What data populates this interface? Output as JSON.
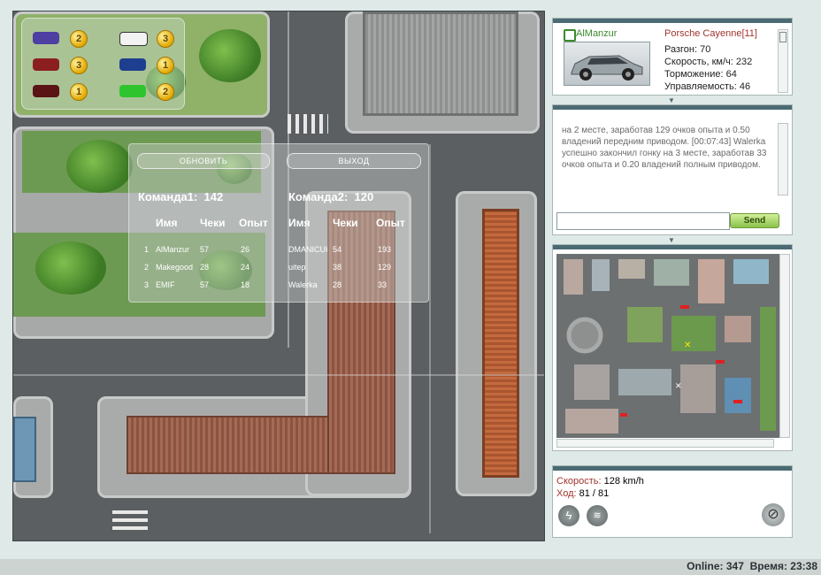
{
  "cars_legend": [
    {
      "color": "#4e3fa3",
      "count": "2"
    },
    {
      "color": "#f2f2f2",
      "count": "3"
    },
    {
      "color": "#8b1f1f",
      "count": "3"
    },
    {
      "color": "#1e3f8f",
      "count": "1"
    },
    {
      "color": "#5a1414",
      "count": "1"
    },
    {
      "color": "#2ec42e",
      "count": "2"
    }
  ],
  "score": {
    "refresh_label": "ОБНОВИТЬ",
    "exit_label": "ВЫХОД",
    "team1_label": "Команда1:",
    "team1_score": "142",
    "team2_label": "Команда2:",
    "team2_score": "120",
    "col_name": "Имя",
    "col_checks": "Чеки",
    "col_exp": "Опыт",
    "team1_rows": [
      {
        "n": "1",
        "name": "AlManzur",
        "checks": "57",
        "exp": "26"
      },
      {
        "n": "2",
        "name": "Makegood",
        "checks": "28",
        "exp": "24"
      },
      {
        "n": "3",
        "name": "EMIF",
        "checks": "57",
        "exp": "18"
      }
    ],
    "team2_rows": [
      {
        "name": "DMANICUK",
        "checks": "54",
        "exp": "193"
      },
      {
        "name": "uitep",
        "checks": "38",
        "exp": "129"
      },
      {
        "name": "Walerka",
        "checks": "28",
        "exp": "33"
      }
    ]
  },
  "car_panel": {
    "player": "AlManzur",
    "car": "Porsche Cayenne[11]",
    "stats": [
      "Разгон: 70",
      "Скорость, км/ч: 232",
      "Торможение: 64",
      "Управляемость: 46"
    ]
  },
  "chat": {
    "messages": "на 2 месте, заработав 129 очков опыта и 0.50 владений передним приводом. [00:07:43] Walerka успешно закончил гонку на 3 месте, заработав 33 очков опыта и 0.20 владений полным приводом.",
    "input_value": "",
    "send_label": "Send"
  },
  "speed": {
    "speed_label": "Скорость:",
    "speed_value": "128 km/h",
    "move_label": "Ход:",
    "move_value": "81 / 81"
  },
  "status": {
    "online_label": "Online:",
    "online_value": "347",
    "time_label": "Время:",
    "time_value": "23:38"
  },
  "colors": {
    "accent": "#4c6a74",
    "panel_red": "#a0342c",
    "send_green": "#8bc34a"
  }
}
